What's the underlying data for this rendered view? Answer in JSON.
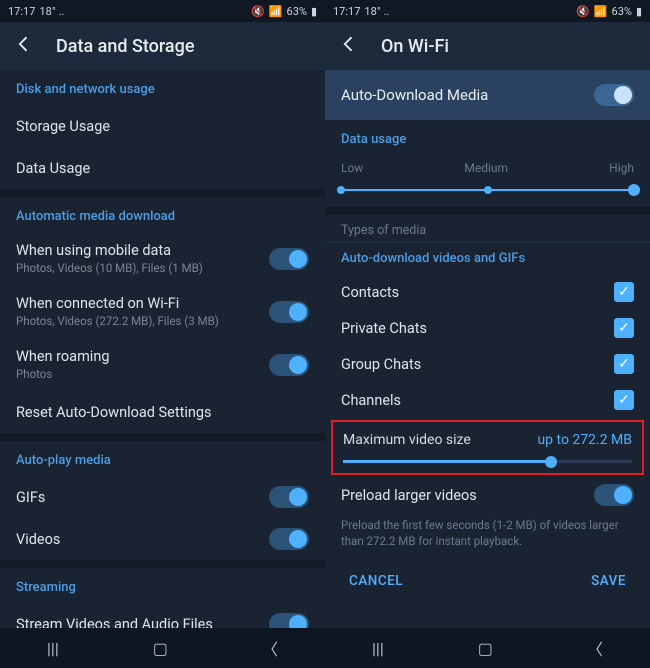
{
  "statusbar": {
    "time": "17:17",
    "temp": "18°",
    "extra": "18°  ..",
    "battery": "63%",
    "signal": "▲",
    "wifi": "◢"
  },
  "left": {
    "title": "Data and Storage",
    "disk_network_header": "Disk and network usage",
    "storage_usage": "Storage Usage",
    "data_usage": "Data Usage",
    "auto_media_header": "Automatic media download",
    "mobile_data_label": "When using mobile data",
    "mobile_data_sub": "Photos, Videos (10 MB), Files (1 MB)",
    "wifi_label": "When connected on Wi-Fi",
    "wifi_sub": "Photos, Videos (272.2 MB), Files (3 MB)",
    "roaming_label": "When roaming",
    "roaming_sub": "Photos",
    "reset": "Reset Auto-Download Settings",
    "autoplay_header": "Auto-play media",
    "gifs": "GIFs",
    "videos": "Videos",
    "streaming_header": "Streaming",
    "stream_item": "Stream Videos and Audio Files"
  },
  "right": {
    "title": "On Wi-Fi",
    "auto_dl_media": "Auto-Download Media",
    "data_usage_header": "Data usage",
    "low": "Low",
    "medium": "Medium",
    "high": "High",
    "types_header": "Types of media",
    "auto_dl_videos_header": "Auto-download videos and GIFs",
    "contacts": "Contacts",
    "private_chats": "Private Chats",
    "group_chats": "Group Chats",
    "channels": "Channels",
    "max_video_label": "Maximum video size",
    "max_video_value": "up to 272.2 MB",
    "preload_label": "Preload larger videos",
    "preload_hint": "Preload the first few seconds (1-2 MB) of videos larger than 272.2 MB for instant playback.",
    "cancel": "CANCEL",
    "save": "SAVE"
  },
  "sliders": {
    "max_video_fill_pct": 72,
    "usage_pos": "high"
  },
  "colors": {
    "accent": "#4fb0ff",
    "danger": "#d3554d"
  }
}
